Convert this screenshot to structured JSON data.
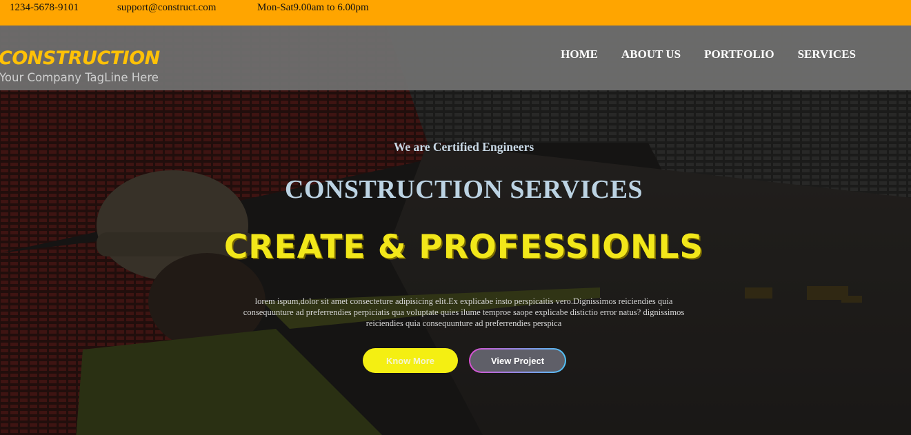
{
  "topbar": {
    "phone": "1234-5678-9101",
    "email": "support@construct.com",
    "hours": "Mon-Sat9.00am to 6.00pm"
  },
  "header": {
    "logo_title": "CONSTRUCTION",
    "logo_tagline": "Your Company TagLine Here",
    "nav": [
      "HOME",
      "ABOUT US",
      "PORTFOLIO",
      "SERVICES"
    ]
  },
  "hero": {
    "eyebrow": "We are Certified Engineers",
    "headline": "CONSTRUCTION SERVICES",
    "tagline": "CREATE & PROFESSIONLS",
    "body": "lorem ispum,dolor sit amet consecteture adipisicing elit.Ex explicabe insto perspicaitis vero.Dignissimos reiciendies quia consequunture ad preferrendies perpiciatis qua voluptate quies ilume temproe saope explicabe distictio error natus? dignissimos reiciendies quia consequunture ad preferrendies perspica",
    "buttons": {
      "know_more": "Know More",
      "view_project": "View Project"
    }
  },
  "colors": {
    "topbar_bg": "#FFA500",
    "logo_accent": "#FFC107",
    "tagline_yellow": "#F2E71A",
    "button_yellow": "#F4EF12",
    "header_bg": "#707070"
  }
}
